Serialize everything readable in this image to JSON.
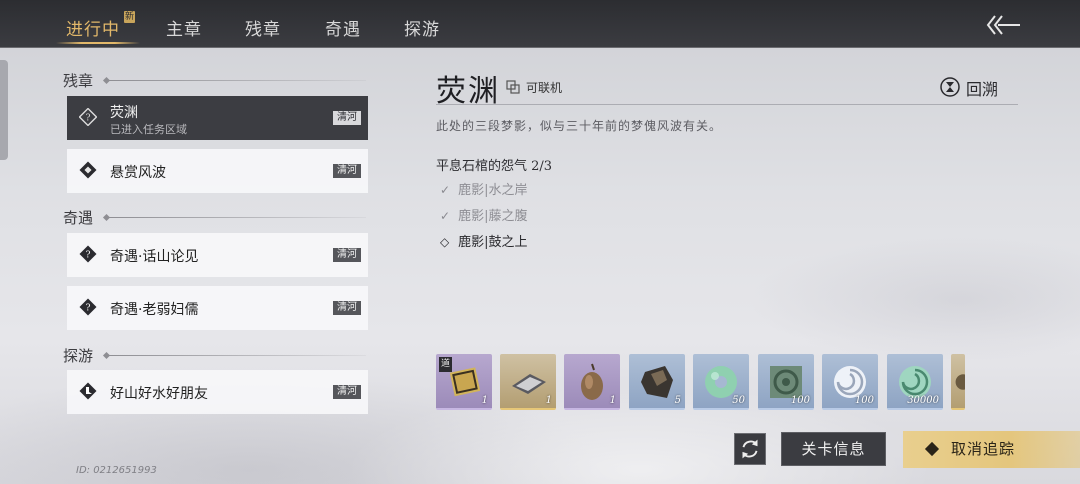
{
  "tabs": [
    {
      "label": "进行中",
      "active": true,
      "badge": "新"
    },
    {
      "label": "主章"
    },
    {
      "label": "残章"
    },
    {
      "label": "奇遇"
    },
    {
      "label": "探游"
    }
  ],
  "sections": {
    "canzhang": "残章",
    "qiyu": "奇遇",
    "tanyou": "探游"
  },
  "quests": [
    {
      "title": "荧渊",
      "subtitle": "已进入任务区域",
      "tag": "清河",
      "active": true
    },
    {
      "title": "悬赏风波",
      "tag": "清河"
    },
    {
      "title": "奇遇·话山论见",
      "tag": "清河"
    },
    {
      "title": "奇遇·老弱妇儒",
      "tag": "清河"
    },
    {
      "title": "好山好水好朋友",
      "tag": "清河"
    }
  ],
  "detail": {
    "title": "荧渊",
    "coop": "可联机",
    "rewind": "回溯",
    "description": "此处的三段梦影，似与三十年前的梦傀风波有关。",
    "objective": "平息石棺的怨气 2/3",
    "subgoals": [
      {
        "text": "鹿影|水之岸",
        "done": true
      },
      {
        "text": "鹿影|藤之腹",
        "done": true
      },
      {
        "text": "鹿影|鼓之上",
        "done": false
      }
    ]
  },
  "rewards": [
    {
      "qty": "1",
      "tag": "道"
    },
    {
      "qty": "1"
    },
    {
      "qty": "1"
    },
    {
      "qty": "5"
    },
    {
      "qty": "50"
    },
    {
      "qty": "100"
    },
    {
      "qty": "100"
    },
    {
      "qty": "30000"
    }
  ],
  "buttons": {
    "info": "关卡信息",
    "cancel": "取消追踪"
  },
  "uid": "ID: 0212651993"
}
